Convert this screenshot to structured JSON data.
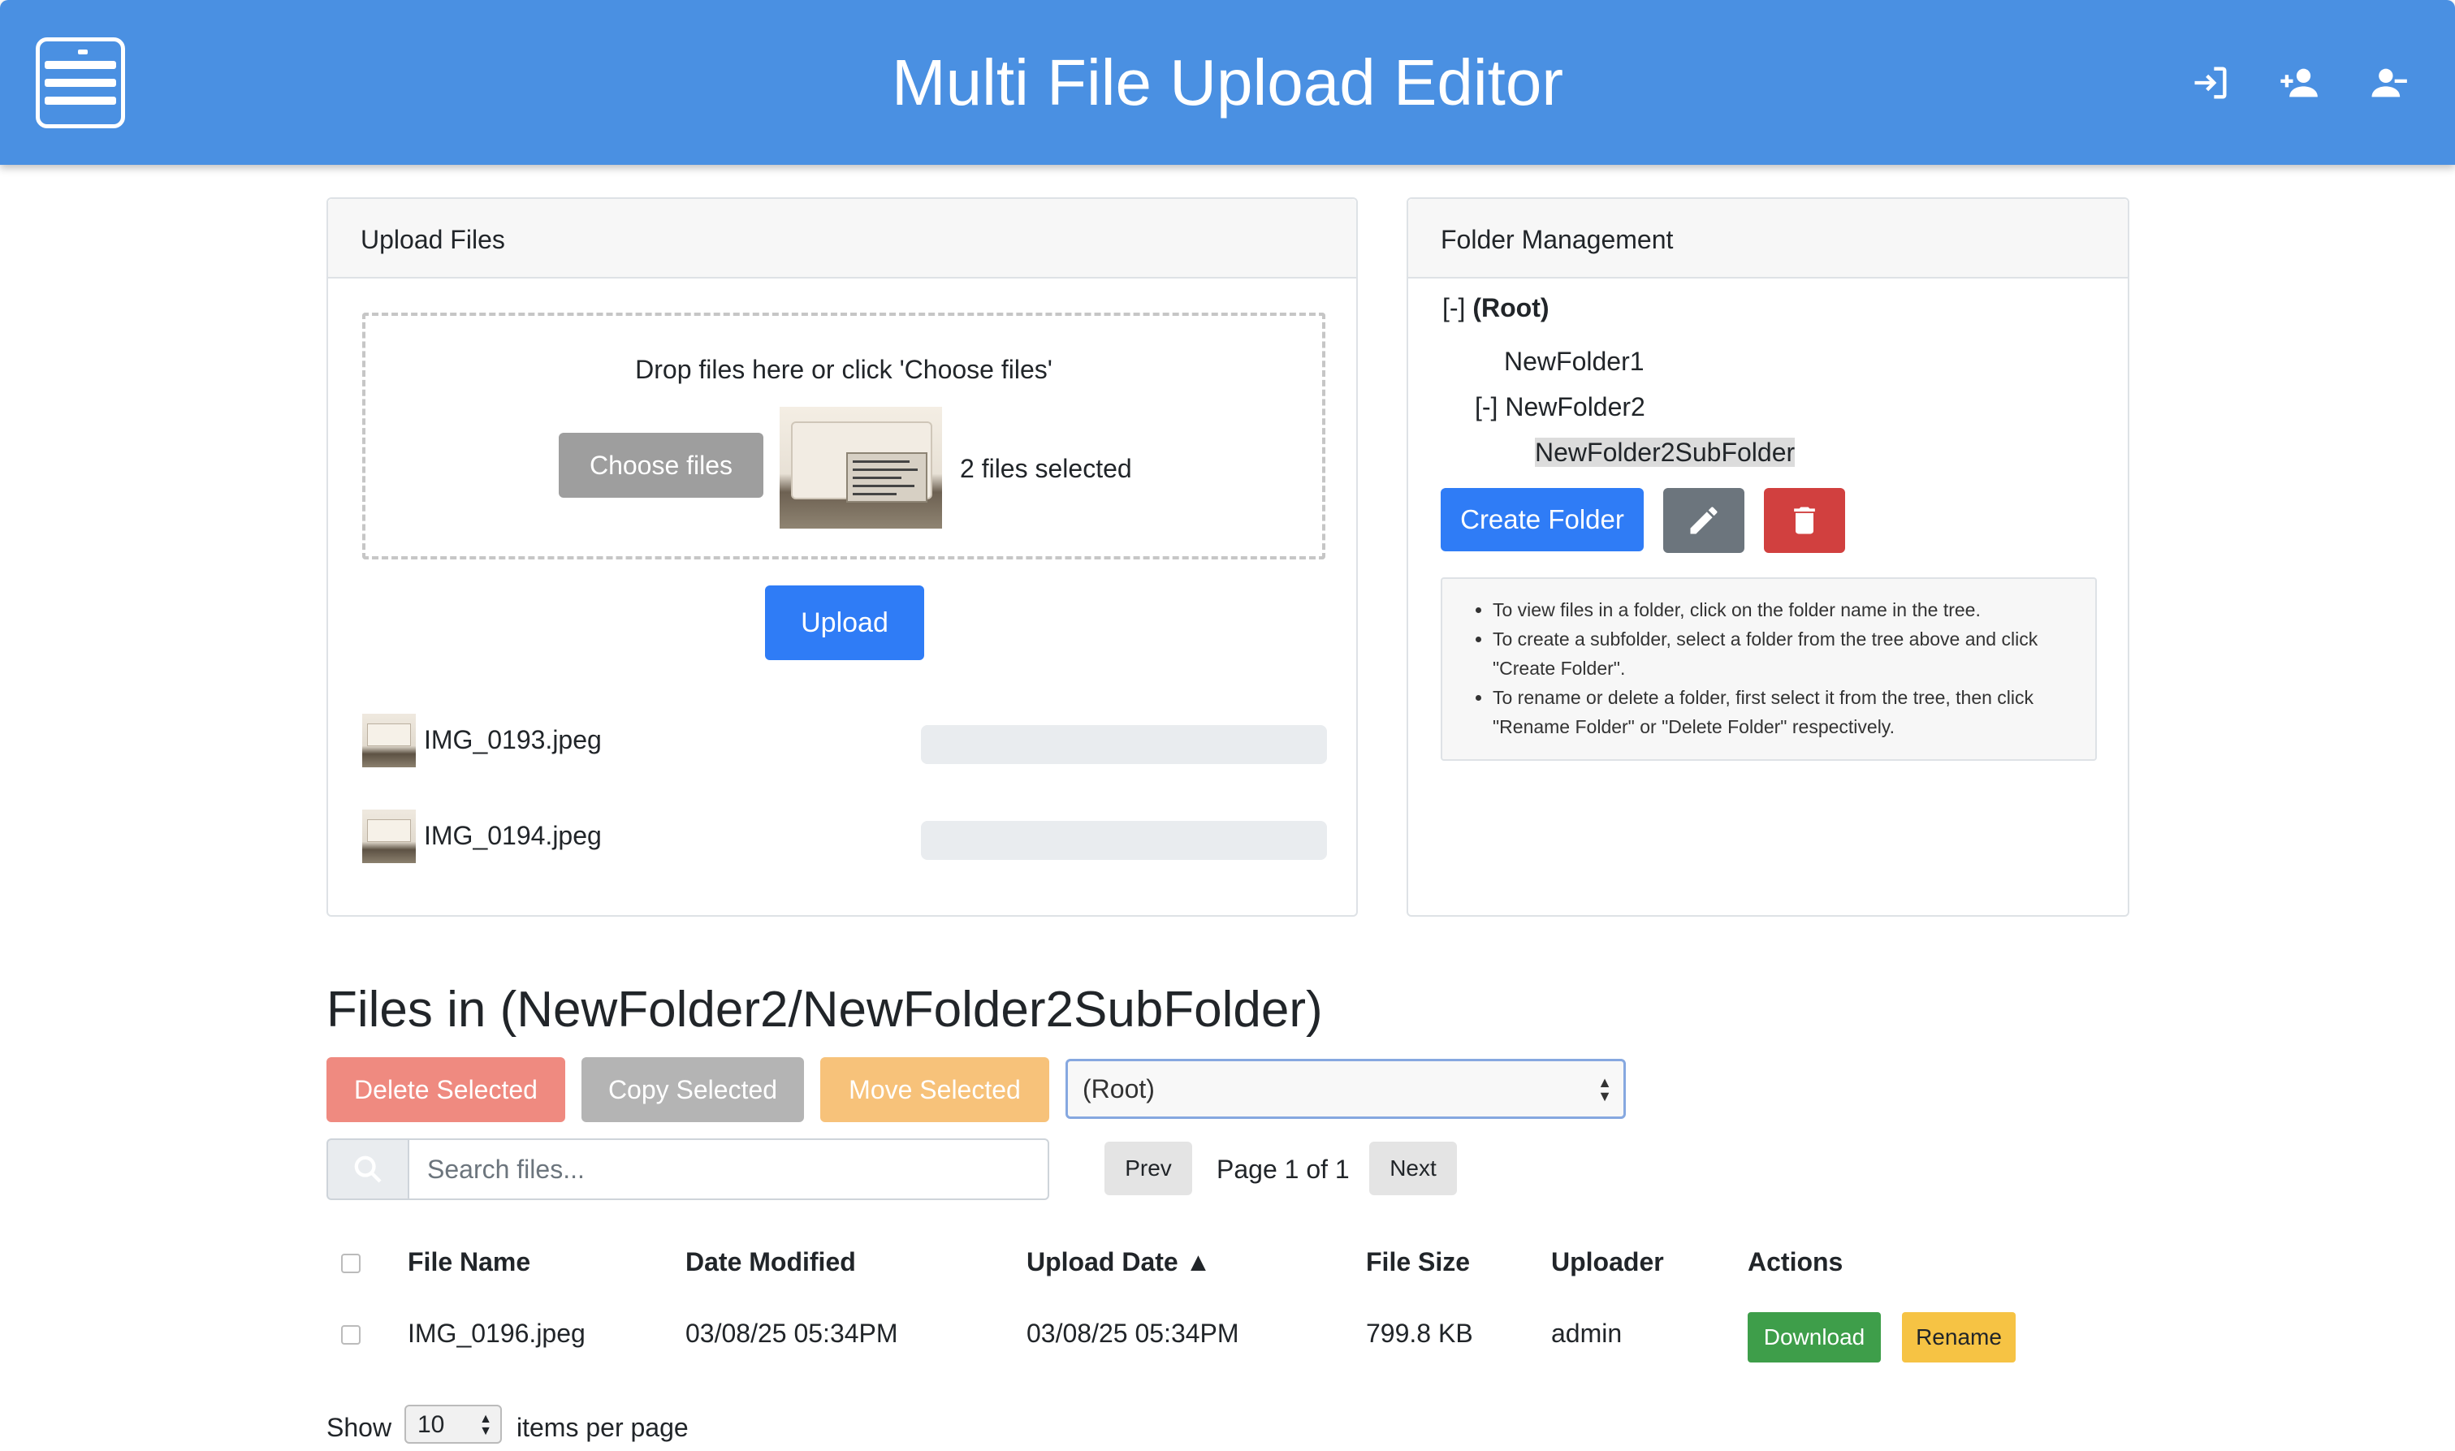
{
  "app": {
    "title": "Multi File Upload Editor",
    "colors": {
      "header": "#4a90e2",
      "primary": "#2f7cf6"
    }
  },
  "header_icons": [
    "login-icon",
    "add-user-icon",
    "remove-user-icon"
  ],
  "upload": {
    "card_title": "Upload Files",
    "drop_text": "Drop files here or click 'Choose files'",
    "choose_label": "Choose files",
    "selected_text": "2 files selected",
    "upload_label": "Upload",
    "files": [
      {
        "name": "IMG_0193.jpeg",
        "progress": 0
      },
      {
        "name": "IMG_0194.jpeg",
        "progress": 0
      }
    ]
  },
  "folders": {
    "card_title": "Folder Management",
    "root_toggle": "[-]",
    "root_label": "(Root)",
    "items": [
      {
        "label": "NewFolder1"
      },
      {
        "toggle": "[-]",
        "label": "NewFolder2"
      },
      {
        "label": "NewFolder2SubFolder",
        "selected": true
      }
    ],
    "create_label": "Create Folder",
    "help": [
      "To view files in a folder, click on the folder name in the tree.",
      "To create a subfolder, select a folder from the tree above and click \"Create Folder\".",
      "To rename or delete a folder, first select it from the tree, then click \"Rename Folder\" or \"Delete Folder\" respectively."
    ]
  },
  "files_section": {
    "title": "Files in (NewFolder2/NewFolder2SubFolder)",
    "delete_label": "Delete Selected",
    "copy_label": "Copy Selected",
    "move_label": "Move Selected",
    "target_folder": "(Root)",
    "search_placeholder": "Search files...",
    "prev_label": "Prev",
    "page_info": "Page 1 of 1",
    "next_label": "Next",
    "columns": [
      "File Name",
      "Date Modified",
      "Upload Date ▲",
      "File Size",
      "Uploader",
      "Actions"
    ],
    "rows": [
      {
        "name": "IMG_0196.jpeg",
        "modified": "03/08/25 05:34PM",
        "uploaded": "03/08/25 05:34PM",
        "size": "799.8 KB",
        "uploader": "admin",
        "download_label": "Download",
        "rename_label": "Rename"
      }
    ],
    "show_label": "Show",
    "per_page": "10",
    "per_page_suffix": "items per page"
  }
}
